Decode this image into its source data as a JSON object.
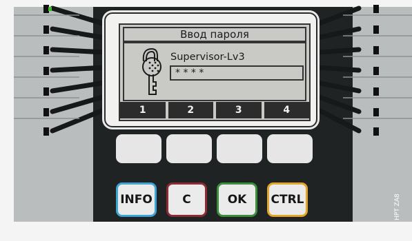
{
  "display": {
    "title": "Ввод пароля",
    "user_level": "Supervisor-Lv3",
    "password_mask": "* * * *",
    "softkeys": [
      "1",
      "2",
      "3",
      "4"
    ]
  },
  "buttons": {
    "info": "INFO",
    "c": "C",
    "ok": "OK",
    "ctrl": "CTRL"
  },
  "colors": {
    "info_border": "#3ea4d6",
    "c_border": "#8e2a34",
    "ok_border": "#3b8e3a",
    "ctrl_border": "#e4a629",
    "status_led": "#3fbe2e"
  },
  "icons": {
    "display_icon": "key-icon"
  },
  "figure_code": "HPT ZA8"
}
